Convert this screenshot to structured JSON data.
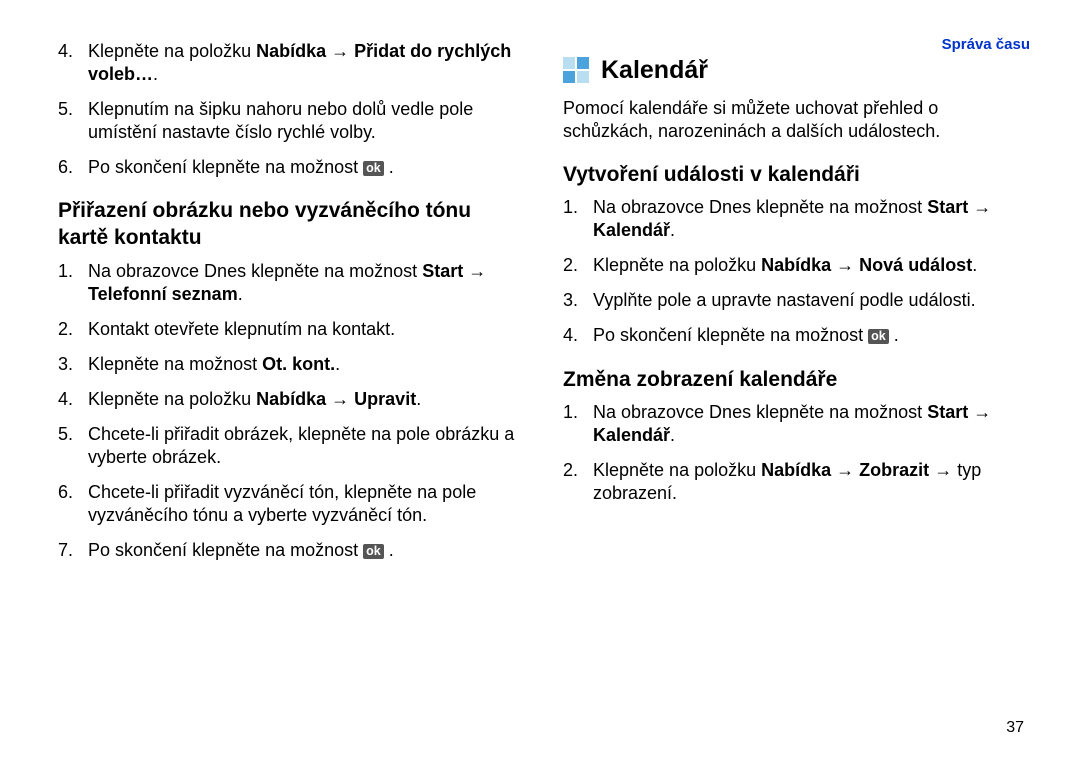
{
  "header": {
    "section_link": "Správa času"
  },
  "ok_label": "ok",
  "left": {
    "list1": {
      "start": 4,
      "items": [
        {
          "pre": "Klepněte na položku ",
          "bold": "Nabídka → Přidat do rychlých voleb…",
          "post": "."
        },
        {
          "pre": "Klepnutím na šipku nahoru nebo dolů vedle pole umístění nastavte číslo rychlé volby.",
          "bold": "",
          "post": ""
        },
        {
          "pre": "Po skončení klepněte na možnost ",
          "bold": "",
          "post": "",
          "ok": true,
          "post2": " ."
        }
      ]
    },
    "h2": "Přiřazení obrázku nebo vyzváněcího tónu kartě kontaktu",
    "list2": {
      "start": 1,
      "items": [
        {
          "pre": "Na obrazovce Dnes klepněte na možnost ",
          "bold": "Start → Telefonní seznam",
          "post": "."
        },
        {
          "pre": "Kontakt otevřete klepnutím na kontakt.",
          "bold": "",
          "post": ""
        },
        {
          "pre": "Klepněte na možnost ",
          "bold": "Ot. kont.",
          "post": "."
        },
        {
          "pre": "Klepněte na položku ",
          "bold": "Nabídka → Upravit",
          "post": "."
        },
        {
          "pre": "Chcete-li přiřadit obrázek, klepněte na pole obrázku a vyberte obrázek.",
          "bold": "",
          "post": ""
        },
        {
          "pre": "Chcete-li přiřadit vyzváněcí tón, klepněte na pole vyzváněcího tónu a vyberte vyzváněcí tón.",
          "bold": "",
          "post": ""
        },
        {
          "pre": "Po skončení klepněte na možnost ",
          "bold": "",
          "post": "",
          "ok": true,
          "post2": " ."
        }
      ]
    }
  },
  "right": {
    "h1": "Kalendář",
    "intro": "Pomocí kalendáře si můžete uchovat přehled o schůzkách, narozeninách a dalších událostech.",
    "h2a": "Vytvoření události v kalendáři",
    "list_a": {
      "start": 1,
      "items": [
        {
          "pre": "Na obrazovce Dnes klepněte na možnost ",
          "bold": "Start → Kalendář",
          "post": "."
        },
        {
          "pre": "Klepněte na položku ",
          "bold": "Nabídka → Nová událost",
          "post": "."
        },
        {
          "pre": "Vyplňte pole a upravte nastavení podle události.",
          "bold": "",
          "post": ""
        },
        {
          "pre": "Po skončení klepněte na možnost ",
          "bold": "",
          "post": "",
          "ok": true,
          "post2": " ."
        }
      ]
    },
    "h2b": "Změna zobrazení kalendáře",
    "list_b": {
      "start": 1,
      "items": [
        {
          "pre": "Na obrazovce Dnes klepněte na možnost ",
          "bold": "Start → Kalendář",
          "post": "."
        },
        {
          "pre": "Klepněte na položku ",
          "bold": "Nabídka → Zobrazit",
          "post": " → typ zobrazení."
        }
      ]
    }
  },
  "page_number": "37"
}
